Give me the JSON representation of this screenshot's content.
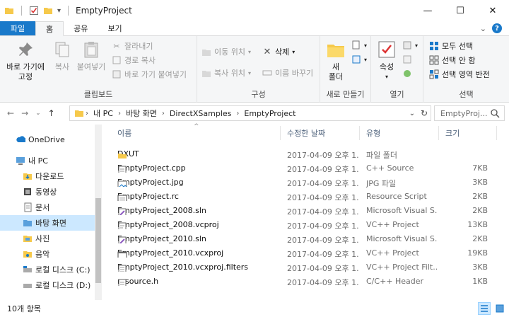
{
  "window": {
    "title": "EmptyProject",
    "minimize": "—",
    "maximize": "☐",
    "close": "✕"
  },
  "qat": {
    "dropdown": "▾"
  },
  "tabs": [
    {
      "label": "파일"
    },
    {
      "label": "홈"
    },
    {
      "label": "공유"
    },
    {
      "label": "보기"
    }
  ],
  "ribbon": {
    "clipboard": {
      "label": "클립보드",
      "pin": "바로 가기에\n고정",
      "copy": "복사",
      "paste": "붙여넣기",
      "cut": "잘라내기",
      "copy_path": "경로 복사",
      "paste_shortcut": "바로 가기 붙여넣기"
    },
    "organize": {
      "label": "구성",
      "move_to": "이동 위치",
      "copy_to": "복사 위치",
      "delete": "삭제",
      "rename": "이름 바꾸기"
    },
    "new": {
      "label": "새로 만들기",
      "new_folder": "새\n폴더"
    },
    "open": {
      "label": "열기",
      "properties": "속성"
    },
    "select": {
      "label": "선택",
      "select_all": "모두 선택",
      "select_none": "선택 안 함",
      "invert": "선택 영역 반전"
    }
  },
  "address": {
    "crumbs": [
      "내 PC",
      "바탕 화면",
      "DirectXSamples",
      "EmptyProject"
    ],
    "search_placeholder": "EmptyProj..."
  },
  "navpane": {
    "items": [
      {
        "label": "OneDrive",
        "icon": "cloud-icon"
      },
      {
        "label": "내 PC",
        "icon": "computer-icon"
      },
      {
        "label": "다운로드",
        "icon": "download-folder-icon"
      },
      {
        "label": "동영상",
        "icon": "video-folder-icon"
      },
      {
        "label": "문서",
        "icon": "documents-folder-icon"
      },
      {
        "label": "바탕 화면",
        "icon": "desktop-folder-icon",
        "selected": true
      },
      {
        "label": "사진",
        "icon": "pictures-folder-icon"
      },
      {
        "label": "음악",
        "icon": "music-folder-icon"
      },
      {
        "label": "로컬 디스크 (C:)",
        "icon": "drive-c-icon"
      },
      {
        "label": "로컬 디스크 (D:)",
        "icon": "drive-d-icon"
      }
    ]
  },
  "columns": {
    "name": "이름",
    "date": "수정한 날짜",
    "type": "유형",
    "size": "크기"
  },
  "files": [
    {
      "name": "DXUT",
      "date": "2017-04-09 오후 1...",
      "type": "파일 폴더",
      "size": "",
      "icon": "folder-icon"
    },
    {
      "name": "EmptyProject.cpp",
      "date": "2017-04-09 오후 1...",
      "type": "C++ Source",
      "size": "7KB",
      "icon": "cpp-file-icon"
    },
    {
      "name": "EmptyProject.jpg",
      "date": "2017-04-09 오후 1...",
      "type": "JPG 파일",
      "size": "3KB",
      "icon": "image-file-icon"
    },
    {
      "name": "EmptyProject.rc",
      "date": "2017-04-09 오후 1...",
      "type": "Resource Script",
      "size": "2KB",
      "icon": "rc-file-icon"
    },
    {
      "name": "EmptyProject_2008.sln",
      "date": "2017-04-09 오후 1...",
      "type": "Microsoft Visual S...",
      "size": "2KB",
      "icon": "sln-file-icon"
    },
    {
      "name": "EmptyProject_2008.vcproj",
      "date": "2017-04-09 오후 1...",
      "type": "VC++ Project",
      "size": "13KB",
      "icon": "vcproj-file-icon"
    },
    {
      "name": "EmptyProject_2010.sln",
      "date": "2017-04-09 오후 1...",
      "type": "Microsoft Visual S...",
      "size": "2KB",
      "icon": "sln-file-icon"
    },
    {
      "name": "EmptyProject_2010.vcxproj",
      "date": "2017-04-09 오후 1...",
      "type": "VC++ Project",
      "size": "19KB",
      "icon": "vcxproj-file-icon"
    },
    {
      "name": "EmptyProject_2010.vcxproj.filters",
      "date": "2017-04-09 오후 1...",
      "type": "VC++ Project Filt...",
      "size": "3KB",
      "icon": "filters-file-icon"
    },
    {
      "name": "resource.h",
      "date": "2017-04-09 오후 1...",
      "type": "C/C++ Header",
      "size": "1KB",
      "icon": "header-file-icon"
    }
  ],
  "status": {
    "count": "10개 항목"
  },
  "colors": {
    "accent": "#1979ca",
    "selected": "#cce8ff",
    "folder": "#f6c94b"
  }
}
